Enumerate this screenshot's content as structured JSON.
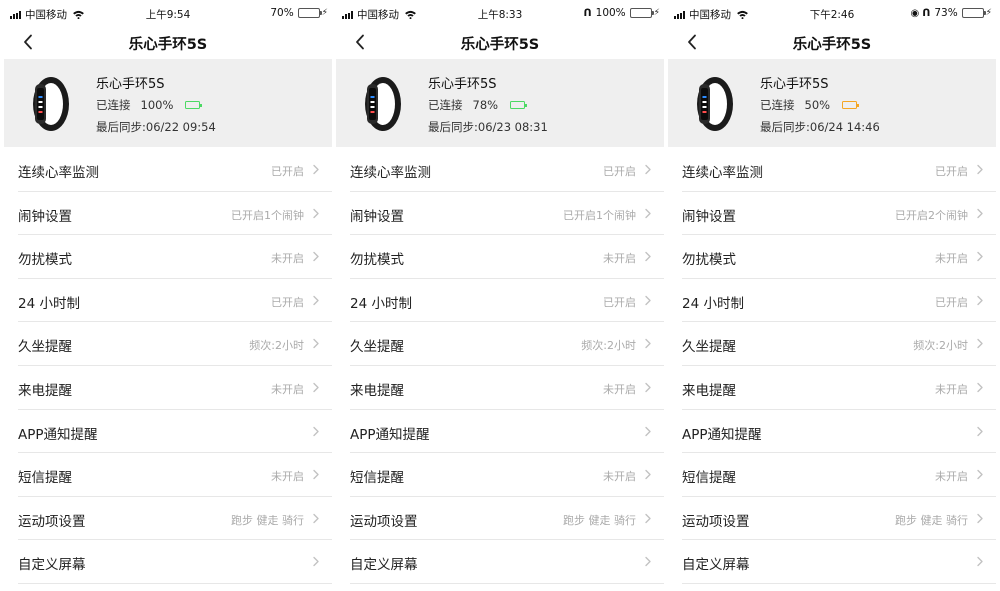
{
  "screens": [
    {
      "status": {
        "carrier": "中国移动",
        "time": "上午9:54",
        "battery_text": "70%",
        "battery_level": 0.7,
        "battery_color": "#4cd964",
        "extras": []
      },
      "nav": {
        "title": "乐心手环5S",
        "back_icon": "chevron-left-icon"
      },
      "device": {
        "name": "乐心手环5S",
        "connection": "已连接",
        "battery": "100%",
        "battery_level": 1.0,
        "battery_color": "#4cd964",
        "last_sync": "最后同步:06/22 09:54"
      },
      "rows": [
        {
          "label": "连续心率监测",
          "value": "已开启"
        },
        {
          "label": "闹钟设置",
          "value": "已开启1个闹钟"
        },
        {
          "label": "勿扰模式",
          "value": "未开启"
        },
        {
          "label": "24 小时制",
          "value": "已开启"
        },
        {
          "label": "久坐提醒",
          "value": "频次:2小时"
        },
        {
          "label": "来电提醒",
          "value": "未开启"
        },
        {
          "label": "APP通知提醒",
          "value": ""
        },
        {
          "label": "短信提醒",
          "value": "未开启"
        },
        {
          "label": "运动项设置",
          "value": "跑步 健走 骑行"
        },
        {
          "label": "自定义屏幕",
          "value": ""
        }
      ]
    },
    {
      "status": {
        "carrier": "中国移动",
        "time": "上午8:33",
        "battery_text": "100%",
        "battery_level": 1.0,
        "battery_color": "#111111",
        "extras": [
          "headphones-icon"
        ]
      },
      "nav": {
        "title": "乐心手环5S",
        "back_icon": "chevron-left-icon"
      },
      "device": {
        "name": "乐心手环5S",
        "connection": "已连接",
        "battery": "78%",
        "battery_level": 0.78,
        "battery_color": "#4cd964",
        "last_sync": "最后同步:06/23 08:31"
      },
      "rows": [
        {
          "label": "连续心率监测",
          "value": "已开启"
        },
        {
          "label": "闹钟设置",
          "value": "已开启1个闹钟"
        },
        {
          "label": "勿扰模式",
          "value": "未开启"
        },
        {
          "label": "24 小时制",
          "value": "已开启"
        },
        {
          "label": "久坐提醒",
          "value": "频次:2小时"
        },
        {
          "label": "来电提醒",
          "value": "未开启"
        },
        {
          "label": "APP通知提醒",
          "value": ""
        },
        {
          "label": "短信提醒",
          "value": "未开启"
        },
        {
          "label": "运动项设置",
          "value": "跑步 健走 骑行"
        },
        {
          "label": "自定义屏幕",
          "value": ""
        }
      ]
    },
    {
      "status": {
        "carrier": "中国移动",
        "time": "下午2:46",
        "battery_text": "73%",
        "battery_level": 0.73,
        "battery_color": "#4cd964",
        "extras": [
          "alarm-icon",
          "headphones-icon"
        ]
      },
      "nav": {
        "title": "乐心手环5S",
        "back_icon": "chevron-left-icon"
      },
      "device": {
        "name": "乐心手环5S",
        "connection": "已连接",
        "battery": "50%",
        "battery_level": 0.5,
        "battery_color": "#f5a623",
        "last_sync": "最后同步:06/24 14:46"
      },
      "rows": [
        {
          "label": "连续心率监测",
          "value": "已开启"
        },
        {
          "label": "闹钟设置",
          "value": "已开启2个闹钟"
        },
        {
          "label": "勿扰模式",
          "value": "未开启"
        },
        {
          "label": "24 小时制",
          "value": "已开启"
        },
        {
          "label": "久坐提醒",
          "value": "频次:2小时"
        },
        {
          "label": "来电提醒",
          "value": "未开启"
        },
        {
          "label": "APP通知提醒",
          "value": ""
        },
        {
          "label": "短信提醒",
          "value": "未开启"
        },
        {
          "label": "运动项设置",
          "value": "跑步 健走 骑行"
        },
        {
          "label": "自定义屏幕",
          "value": ""
        }
      ]
    }
  ]
}
